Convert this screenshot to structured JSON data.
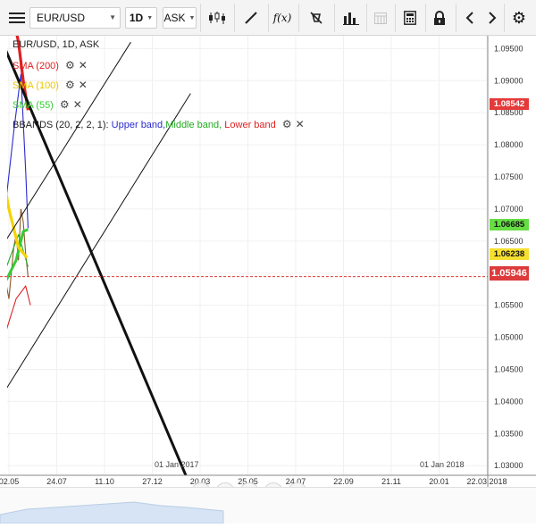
{
  "toolbar": {
    "symbol": "EUR/USD",
    "interval": "1D",
    "price_type": "ASK",
    "icons": [
      "menu-icon",
      "candlestick-icon",
      "draw-line-icon",
      "function-icon",
      "no-magnet-icon",
      "volume-bars-icon",
      "calendar-icon",
      "calculator-icon",
      "lock-icon",
      "arrow-left-icon",
      "arrow-right-icon",
      "gear-icon"
    ]
  },
  "legend": {
    "instrument": "EUR/USD, 1D, ASK",
    "sma200": "SMA (200)",
    "sma100": "SMA (100)",
    "sma55": "SMA (55)",
    "bbands": "BBANDS (20, 2, 2, 1):",
    "upper": "Upper band,",
    "middle": "Middle band,",
    "lower": "Lower band"
  },
  "colors": {
    "sma200": "#e02020",
    "sma100": "#f5d300",
    "sma55": "#33cc33",
    "upper": "#2a2ad0",
    "middle": "#22aa22",
    "lower": "#dd2222",
    "last_price": "#dd3b3b"
  },
  "price_tags": {
    "sma200": "1.08542",
    "sma55": "1.06685",
    "sma100": "1.06238",
    "last": "1.05946"
  },
  "date_labels": {
    "year_2017": "01 Jan 2017",
    "year_2018": "01 Jan 2018"
  },
  "nav_icons": [
    "nav-prev-icon",
    "zoom-out-icon",
    "nav-reset-icon",
    "zoom-in-icon",
    "nav-next-icon"
  ],
  "chart_data": {
    "type": "line",
    "title": "EUR/USD, 1D, ASK",
    "ylim": [
      1.0285,
      1.097
    ],
    "y_ticks": [
      "1.09500",
      "1.09000",
      "1.08500",
      "1.08000",
      "1.07500",
      "1.07000",
      "1.06500",
      "1.06000",
      "1.05500",
      "1.05000",
      "1.04500",
      "1.04000",
      "1.03500",
      "1.03000"
    ],
    "x_ticks": [
      "02.05",
      "24.07",
      "11.10",
      "27.12",
      "20.03",
      "25.05",
      "24.07",
      "22.09",
      "21.11",
      "20.01",
      "22.03.2018"
    ],
    "last_price": 1.05946,
    "series": [
      {
        "name": "SMA (200)",
        "x": [
          0.0,
          0.1,
          0.2,
          0.3,
          0.4
        ],
        "values": [
          1.1,
          1.0995,
          1.096,
          1.09,
          1.0854
        ]
      },
      {
        "name": "SMA (100)",
        "x": [
          -0.6,
          -0.4,
          -0.2,
          0.0,
          0.2,
          0.38
        ],
        "values": [
          1.093,
          1.087,
          1.078,
          1.07,
          1.064,
          1.0624
        ]
      },
      {
        "name": "SMA (55)",
        "x": [
          -0.95,
          -0.8,
          -0.55,
          -0.3,
          -0.05,
          0.15,
          0.3,
          0.4
        ],
        "values": [
          1.088,
          1.079,
          1.071,
          1.064,
          1.059,
          1.062,
          1.0665,
          1.0668
        ]
      },
      {
        "name": "Upper band",
        "x": [
          -1.05,
          -0.95,
          -0.7,
          -0.5,
          -0.2,
          0.1,
          0.25,
          0.35,
          0.4
        ],
        "values": [
          1.098,
          1.085,
          1.065,
          1.068,
          1.062,
          1.082,
          1.091,
          1.076,
          1.067
        ]
      },
      {
        "name": "Middle band",
        "x": [
          -1.05,
          -0.85,
          -0.6,
          -0.3,
          0.0,
          0.2,
          0.4
        ],
        "values": [
          1.085,
          1.07,
          1.05,
          1.056,
          1.062,
          1.066,
          1.061
        ]
      },
      {
        "name": "Lower band",
        "x": [
          -1.05,
          -0.9,
          -0.75,
          -0.55,
          -0.3,
          -0.1,
          0.15,
          0.35,
          0.45
        ],
        "values": [
          1.072,
          1.048,
          1.032,
          1.038,
          1.052,
          1.05,
          1.056,
          1.058,
          1.055
        ]
      },
      {
        "name": "",
        "x": [
          -1.1,
          -1.0,
          -0.95,
          -0.9,
          -0.85,
          -0.8,
          -0.75,
          -0.7,
          -0.65,
          -0.6,
          -0.55,
          -0.5,
          -0.45,
          -0.4,
          -0.35,
          -0.3,
          -0.25,
          -0.2,
          -0.15,
          -0.1,
          -0.05,
          0.0,
          0.05,
          0.1,
          0.15,
          0.2,
          0.25,
          0.3,
          0.35,
          0.4
        ],
        "values": [
          1.098,
          1.088,
          1.075,
          1.062,
          1.052,
          1.045,
          1.039,
          1.042,
          1.05,
          1.056,
          1.048,
          1.043,
          1.05,
          1.056,
          1.062,
          1.058,
          1.054,
          1.059,
          1.052,
          1.054,
          1.058,
          1.056,
          1.06,
          1.064,
          1.066,
          1.062,
          1.07,
          1.068,
          1.063,
          1.0595
        ]
      }
    ],
    "trendlines": [
      {
        "points": [
          [
            -2.95,
            1.031
          ],
          [
            2.55,
            1.096
          ]
        ],
        "width": 1
      },
      {
        "points": [
          [
            -1.1,
            1.0295
          ],
          [
            3.8,
            1.088
          ]
        ],
        "width": 1
      },
      {
        "points": [
          [
            -0.28,
            1.0985
          ],
          [
            3.7,
            1.0285
          ]
        ],
        "width": 3
      }
    ]
  }
}
